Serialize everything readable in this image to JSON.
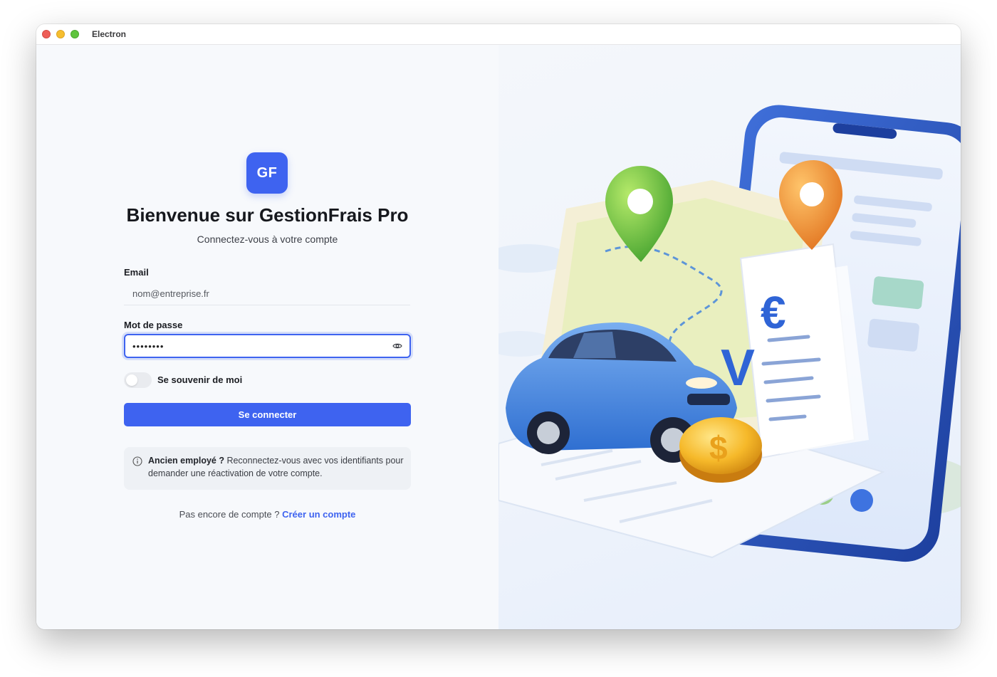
{
  "window": {
    "title": "Electron"
  },
  "brand": {
    "logo_text": "GF",
    "accent": "#3e63f0"
  },
  "login": {
    "title": "Bienvenue sur GestionFrais Pro",
    "subtitle": "Connectez-vous à votre compte",
    "email": {
      "label": "Email",
      "placeholder": "nom@entreprise.fr",
      "value": ""
    },
    "password": {
      "label": "Mot de passe",
      "value": "••••••••",
      "toggle_icon": "eye-icon"
    },
    "remember": {
      "label": "Se souvenir de moi",
      "checked": false
    },
    "submit_label": "Se connecter",
    "info": {
      "icon": "info-icon",
      "bold_text": "Ancien employé ?",
      "text": " Reconnectez-vous avec vos identifiants pour demander une réactivation de votre compte."
    },
    "signup": {
      "prompt": "Pas encore de compte ? ",
      "link_label": "Créer un compte"
    }
  }
}
